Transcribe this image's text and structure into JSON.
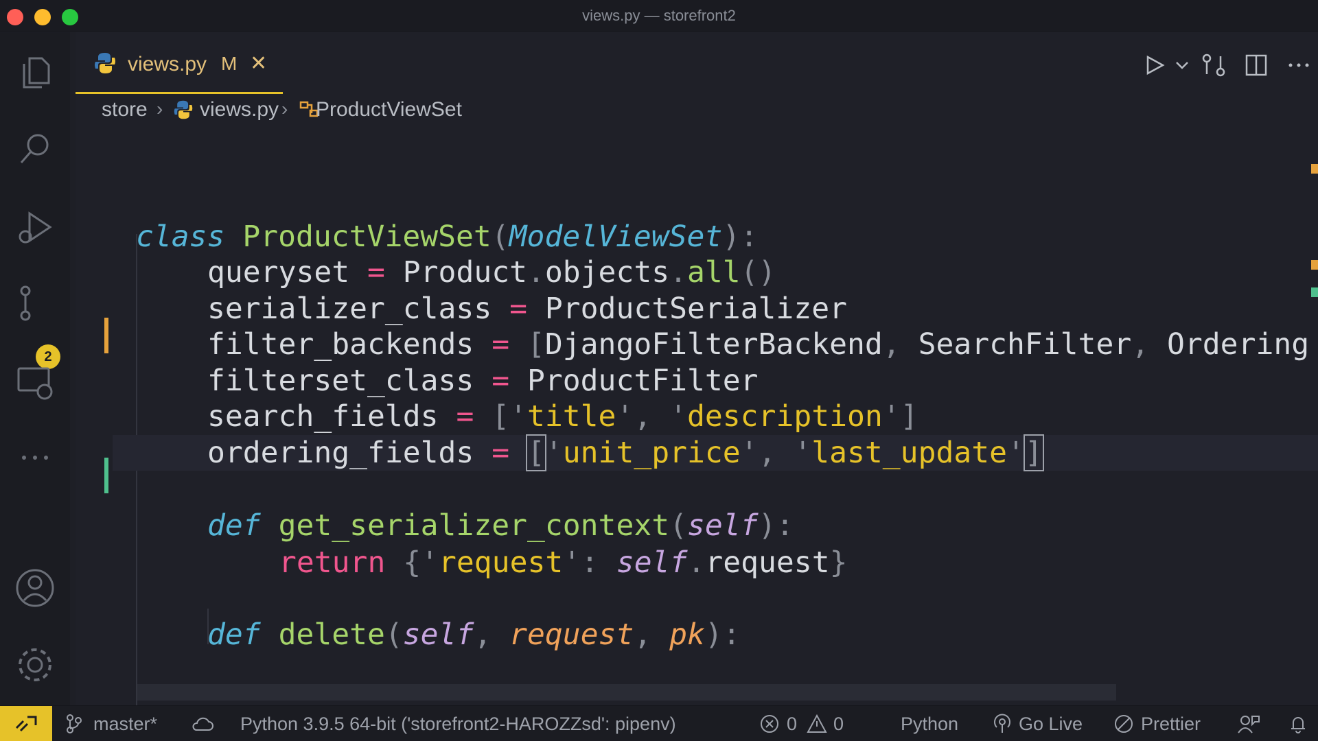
{
  "window": {
    "title": "views.py — storefront2"
  },
  "activity_bar": {
    "scm_badge": "2",
    "items": [
      {
        "name": "explorer-icon"
      },
      {
        "name": "search-icon"
      },
      {
        "name": "run-debug-icon"
      },
      {
        "name": "source-control-icon"
      },
      {
        "name": "remote-explorer-icon"
      },
      {
        "name": "more-icon"
      },
      {
        "name": "accounts-icon"
      },
      {
        "name": "settings-gear-icon"
      }
    ]
  },
  "tab": {
    "name": "views.py",
    "status": "M",
    "close": "✕"
  },
  "breadcrumb": {
    "folder": "store",
    "file": "views.py",
    "symbol": "ProductViewSet"
  },
  "code": {
    "l1": {
      "kw": "class",
      "cls": "ProductViewSet",
      "base": "ModelViewSet"
    },
    "l2": {
      "name": "queryset",
      "model": "Product",
      "attr": "objects",
      "method": "all"
    },
    "l3": {
      "name": "serializer_class",
      "value": "ProductSerializer"
    },
    "l4": {
      "name": "filter_backends",
      "v1": "DjangoFilterBackend",
      "v2": "SearchFilter",
      "v3": "Ordering"
    },
    "l5": {
      "name": "filterset_class",
      "value": "ProductFilter"
    },
    "l6": {
      "name": "search_fields",
      "s1": "title",
      "s2": "description"
    },
    "l7": {
      "name": "ordering_fields",
      "s1": "unit_price",
      "s2": "last_update"
    },
    "l9": {
      "kw": "def",
      "fn": "get_serializer_context",
      "self": "self"
    },
    "l10": {
      "kw": "return",
      "key": "request",
      "self": "self",
      "attr": "request"
    },
    "l12": {
      "kw": "def",
      "fn": "delete",
      "self": "self",
      "p1": "request",
      "p2": "pk"
    }
  },
  "status_bar": {
    "branch": "master*",
    "interpreter": "Python 3.9.5 64-bit ('storefront2-HAROZZsd': pipenv)",
    "errors": "0",
    "warnings": "0",
    "language": "Python",
    "go_live": "Go Live",
    "prettier": "Prettier"
  },
  "colors": {
    "accent": "#e6c229",
    "modified_gutter": "#e6a23c",
    "added_gutter": "#4fc08d"
  }
}
